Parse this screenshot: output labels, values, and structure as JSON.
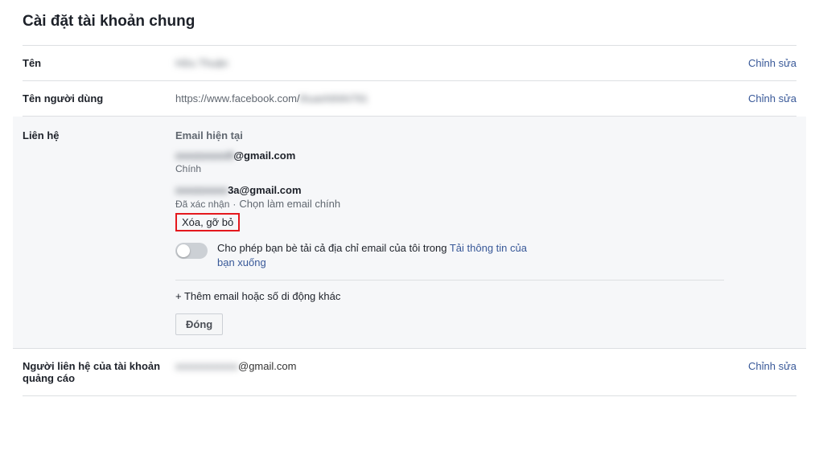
{
  "page_title": "Cài đặt tài khoản chung",
  "edit_label": "Chỉnh sửa",
  "rows": {
    "name": {
      "label": "Tên",
      "value_hidden": "Hữu Thuận"
    },
    "username": {
      "label": "Tên người dùng",
      "url_prefix": "https://www.facebook.com/",
      "value_hidden": "thuanhihihi791"
    },
    "contact": {
      "label": "Liên hệ",
      "heading": "Email hiện tại",
      "emails": [
        {
          "hidden_part": "xxxxxxxxx9",
          "visible_part": "@gmail.com",
          "sub_label": "Chính"
        },
        {
          "hidden_part": "xxxxxxxxx",
          "visible_part": "3a@gmail.com",
          "status": "Đã xác nhận",
          "make_primary": "Chọn làm email chính",
          "remove_label": "Xóa, gỡ bỏ"
        }
      ],
      "toggle": {
        "text_before": "Cho phép bạn bè tải cả địa chỉ email của tôi trong ",
        "link": "Tải thông tin của bạn xuống"
      },
      "add_more": "+ Thêm email hoặc số di động khác",
      "close_label": "Đóng"
    },
    "ad_contact": {
      "label": "Người liên hệ của tài khoản quảng cáo",
      "hidden_part": "xxxxxxxxxxxx",
      "visible_part": "@gmail.com"
    }
  }
}
